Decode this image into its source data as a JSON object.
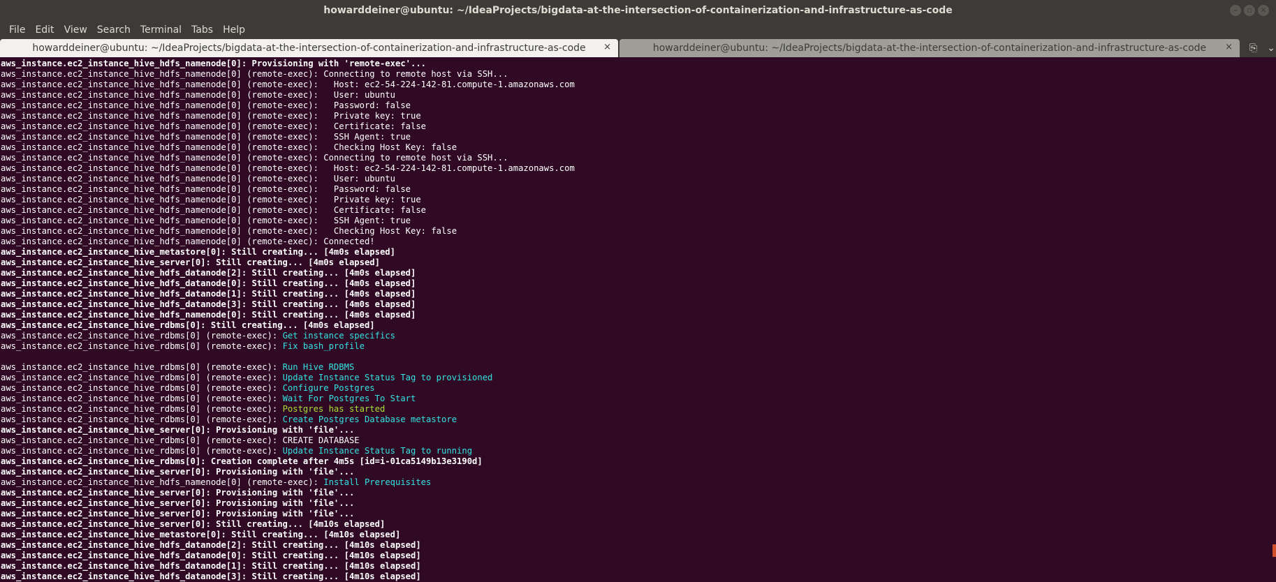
{
  "window": {
    "title": "howarddeiner@ubuntu: ~/IdeaProjects/bigdata-at-the-intersection-of-containerization-and-infrastructure-as-code",
    "minimize": "–",
    "maximize": "▫",
    "close": "✕"
  },
  "menu": [
    "File",
    "Edit",
    "View",
    "Search",
    "Terminal",
    "Tabs",
    "Help"
  ],
  "tabs": [
    {
      "label": "howarddeiner@ubuntu: ~/IdeaProjects/bigdata-at-the-intersection-of-containerization-and-infrastructure-as-code",
      "close": "×"
    },
    {
      "label": "howarddeiner@ubuntu: ~/IdeaProjects/bigdata-at-the-intersection-of-containerization-and-infrastructure-as-code",
      "close": "×"
    }
  ],
  "tab_actions": {
    "new_tab_icon": "⎘",
    "menu_icon": "⌄"
  },
  "lines": [
    {
      "b": "aws_instance.ec2_instance_hive_hdfs_namenode[0]: Provisioning with 'remote-exec'...",
      "n": "",
      "c": ""
    },
    {
      "b": "",
      "n": "aws_instance.ec2_instance_hive_hdfs_namenode[0] (remote-exec): Connecting to remote host via SSH...",
      "c": ""
    },
    {
      "b": "",
      "n": "aws_instance.ec2_instance_hive_hdfs_namenode[0] (remote-exec):   Host: ec2-54-224-142-81.compute-1.amazonaws.com",
      "c": ""
    },
    {
      "b": "",
      "n": "aws_instance.ec2_instance_hive_hdfs_namenode[0] (remote-exec):   User: ubuntu",
      "c": ""
    },
    {
      "b": "",
      "n": "aws_instance.ec2_instance_hive_hdfs_namenode[0] (remote-exec):   Password: false",
      "c": ""
    },
    {
      "b": "",
      "n": "aws_instance.ec2_instance_hive_hdfs_namenode[0] (remote-exec):   Private key: true",
      "c": ""
    },
    {
      "b": "",
      "n": "aws_instance.ec2_instance_hive_hdfs_namenode[0] (remote-exec):   Certificate: false",
      "c": ""
    },
    {
      "b": "",
      "n": "aws_instance.ec2_instance_hive_hdfs_namenode[0] (remote-exec):   SSH Agent: true",
      "c": ""
    },
    {
      "b": "",
      "n": "aws_instance.ec2_instance_hive_hdfs_namenode[0] (remote-exec):   Checking Host Key: false",
      "c": ""
    },
    {
      "b": "",
      "n": "aws_instance.ec2_instance_hive_hdfs_namenode[0] (remote-exec): Connecting to remote host via SSH...",
      "c": ""
    },
    {
      "b": "",
      "n": "aws_instance.ec2_instance_hive_hdfs_namenode[0] (remote-exec):   Host: ec2-54-224-142-81.compute-1.amazonaws.com",
      "c": ""
    },
    {
      "b": "",
      "n": "aws_instance.ec2_instance_hive_hdfs_namenode[0] (remote-exec):   User: ubuntu",
      "c": ""
    },
    {
      "b": "",
      "n": "aws_instance.ec2_instance_hive_hdfs_namenode[0] (remote-exec):   Password: false",
      "c": ""
    },
    {
      "b": "",
      "n": "aws_instance.ec2_instance_hive_hdfs_namenode[0] (remote-exec):   Private key: true",
      "c": ""
    },
    {
      "b": "",
      "n": "aws_instance.ec2_instance_hive_hdfs_namenode[0] (remote-exec):   Certificate: false",
      "c": ""
    },
    {
      "b": "",
      "n": "aws_instance.ec2_instance_hive_hdfs_namenode[0] (remote-exec):   SSH Agent: true",
      "c": ""
    },
    {
      "b": "",
      "n": "aws_instance.ec2_instance_hive_hdfs_namenode[0] (remote-exec):   Checking Host Key: false",
      "c": ""
    },
    {
      "b": "",
      "n": "aws_instance.ec2_instance_hive_hdfs_namenode[0] (remote-exec): Connected!",
      "c": ""
    },
    {
      "b": "aws_instance.ec2_instance_hive_metastore[0]: Still creating... [4m0s elapsed]",
      "n": "",
      "c": ""
    },
    {
      "b": "aws_instance.ec2_instance_hive_server[0]: Still creating... [4m0s elapsed]",
      "n": "",
      "c": ""
    },
    {
      "b": "aws_instance.ec2_instance_hive_hdfs_datanode[2]: Still creating... [4m0s elapsed]",
      "n": "",
      "c": ""
    },
    {
      "b": "aws_instance.ec2_instance_hive_hdfs_datanode[0]: Still creating... [4m0s elapsed]",
      "n": "",
      "c": ""
    },
    {
      "b": "aws_instance.ec2_instance_hive_hdfs_datanode[1]: Still creating... [4m0s elapsed]",
      "n": "",
      "c": ""
    },
    {
      "b": "aws_instance.ec2_instance_hive_hdfs_datanode[3]: Still creating... [4m0s elapsed]",
      "n": "",
      "c": ""
    },
    {
      "b": "aws_instance.ec2_instance_hive_hdfs_namenode[0]: Still creating... [4m0s elapsed]",
      "n": "",
      "c": ""
    },
    {
      "b": "aws_instance.ec2_instance_hive_rdbms[0]: Still creating... [4m0s elapsed]",
      "n": "",
      "c": ""
    },
    {
      "b": "",
      "n": "aws_instance.ec2_instance_hive_rdbms[0] (remote-exec): ",
      "c": "Get instance specifics"
    },
    {
      "b": "",
      "n": "aws_instance.ec2_instance_hive_rdbms[0] (remote-exec): ",
      "c": "Fix bash_profile"
    },
    {
      "b": "",
      "n": "",
      "c": ""
    },
    {
      "b": "",
      "n": "aws_instance.ec2_instance_hive_rdbms[0] (remote-exec): ",
      "c": "Run Hive RDBMS"
    },
    {
      "b": "",
      "n": "aws_instance.ec2_instance_hive_rdbms[0] (remote-exec): ",
      "c": "Update Instance Status Tag to provisioned"
    },
    {
      "b": "",
      "n": "aws_instance.ec2_instance_hive_rdbms[0] (remote-exec): ",
      "c": "Configure Postgres"
    },
    {
      "b": "",
      "n": "aws_instance.ec2_instance_hive_rdbms[0] (remote-exec): ",
      "c": "Wait For Postgres To Start"
    },
    {
      "b": "",
      "n": "aws_instance.ec2_instance_hive_rdbms[0] (remote-exec): ",
      "c": "",
      "y": "Postgres has started"
    },
    {
      "b": "",
      "n": "aws_instance.ec2_instance_hive_rdbms[0] (remote-exec): ",
      "c": "Create Postgres Database metastore"
    },
    {
      "b": "aws_instance.ec2_instance_hive_server[0]: Provisioning with 'file'...",
      "n": "",
      "c": ""
    },
    {
      "b": "",
      "n": "aws_instance.ec2_instance_hive_rdbms[0] (remote-exec): CREATE DATABASE",
      "c": ""
    },
    {
      "b": "",
      "n": "aws_instance.ec2_instance_hive_rdbms[0] (remote-exec): ",
      "c": "Update Instance Status Tag to running"
    },
    {
      "b": "aws_instance.ec2_instance_hive_rdbms[0]: Creation complete after 4m5s [id=i-01ca5149b13e3190d]",
      "n": "",
      "c": ""
    },
    {
      "b": "aws_instance.ec2_instance_hive_server[0]: Provisioning with 'file'...",
      "n": "",
      "c": ""
    },
    {
      "b": "",
      "n": "aws_instance.ec2_instance_hive_hdfs_namenode[0] (remote-exec): ",
      "c": "Install Prerequisites"
    },
    {
      "b": "aws_instance.ec2_instance_hive_server[0]: Provisioning with 'file'...",
      "n": "",
      "c": ""
    },
    {
      "b": "aws_instance.ec2_instance_hive_server[0]: Provisioning with 'file'...",
      "n": "",
      "c": ""
    },
    {
      "b": "aws_instance.ec2_instance_hive_server[0]: Provisioning with 'file'...",
      "n": "",
      "c": ""
    },
    {
      "b": "aws_instance.ec2_instance_hive_server[0]: Still creating... [4m10s elapsed]",
      "n": "",
      "c": ""
    },
    {
      "b": "aws_instance.ec2_instance_hive_metastore[0]: Still creating... [4m10s elapsed]",
      "n": "",
      "c": ""
    },
    {
      "b": "aws_instance.ec2_instance_hive_hdfs_datanode[2]: Still creating... [4m10s elapsed]",
      "n": "",
      "c": ""
    },
    {
      "b": "aws_instance.ec2_instance_hive_hdfs_datanode[0]: Still creating... [4m10s elapsed]",
      "n": "",
      "c": ""
    },
    {
      "b": "aws_instance.ec2_instance_hive_hdfs_datanode[1]: Still creating... [4m10s elapsed]",
      "n": "",
      "c": ""
    },
    {
      "b": "aws_instance.ec2_instance_hive_hdfs_datanode[3]: Still creating... [4m10s elapsed]",
      "n": "",
      "c": ""
    }
  ],
  "colors": {
    "background": "#300a24",
    "cyan": "#34e2e2",
    "green": "#a8e234",
    "titlebar": "#3c3b37"
  }
}
